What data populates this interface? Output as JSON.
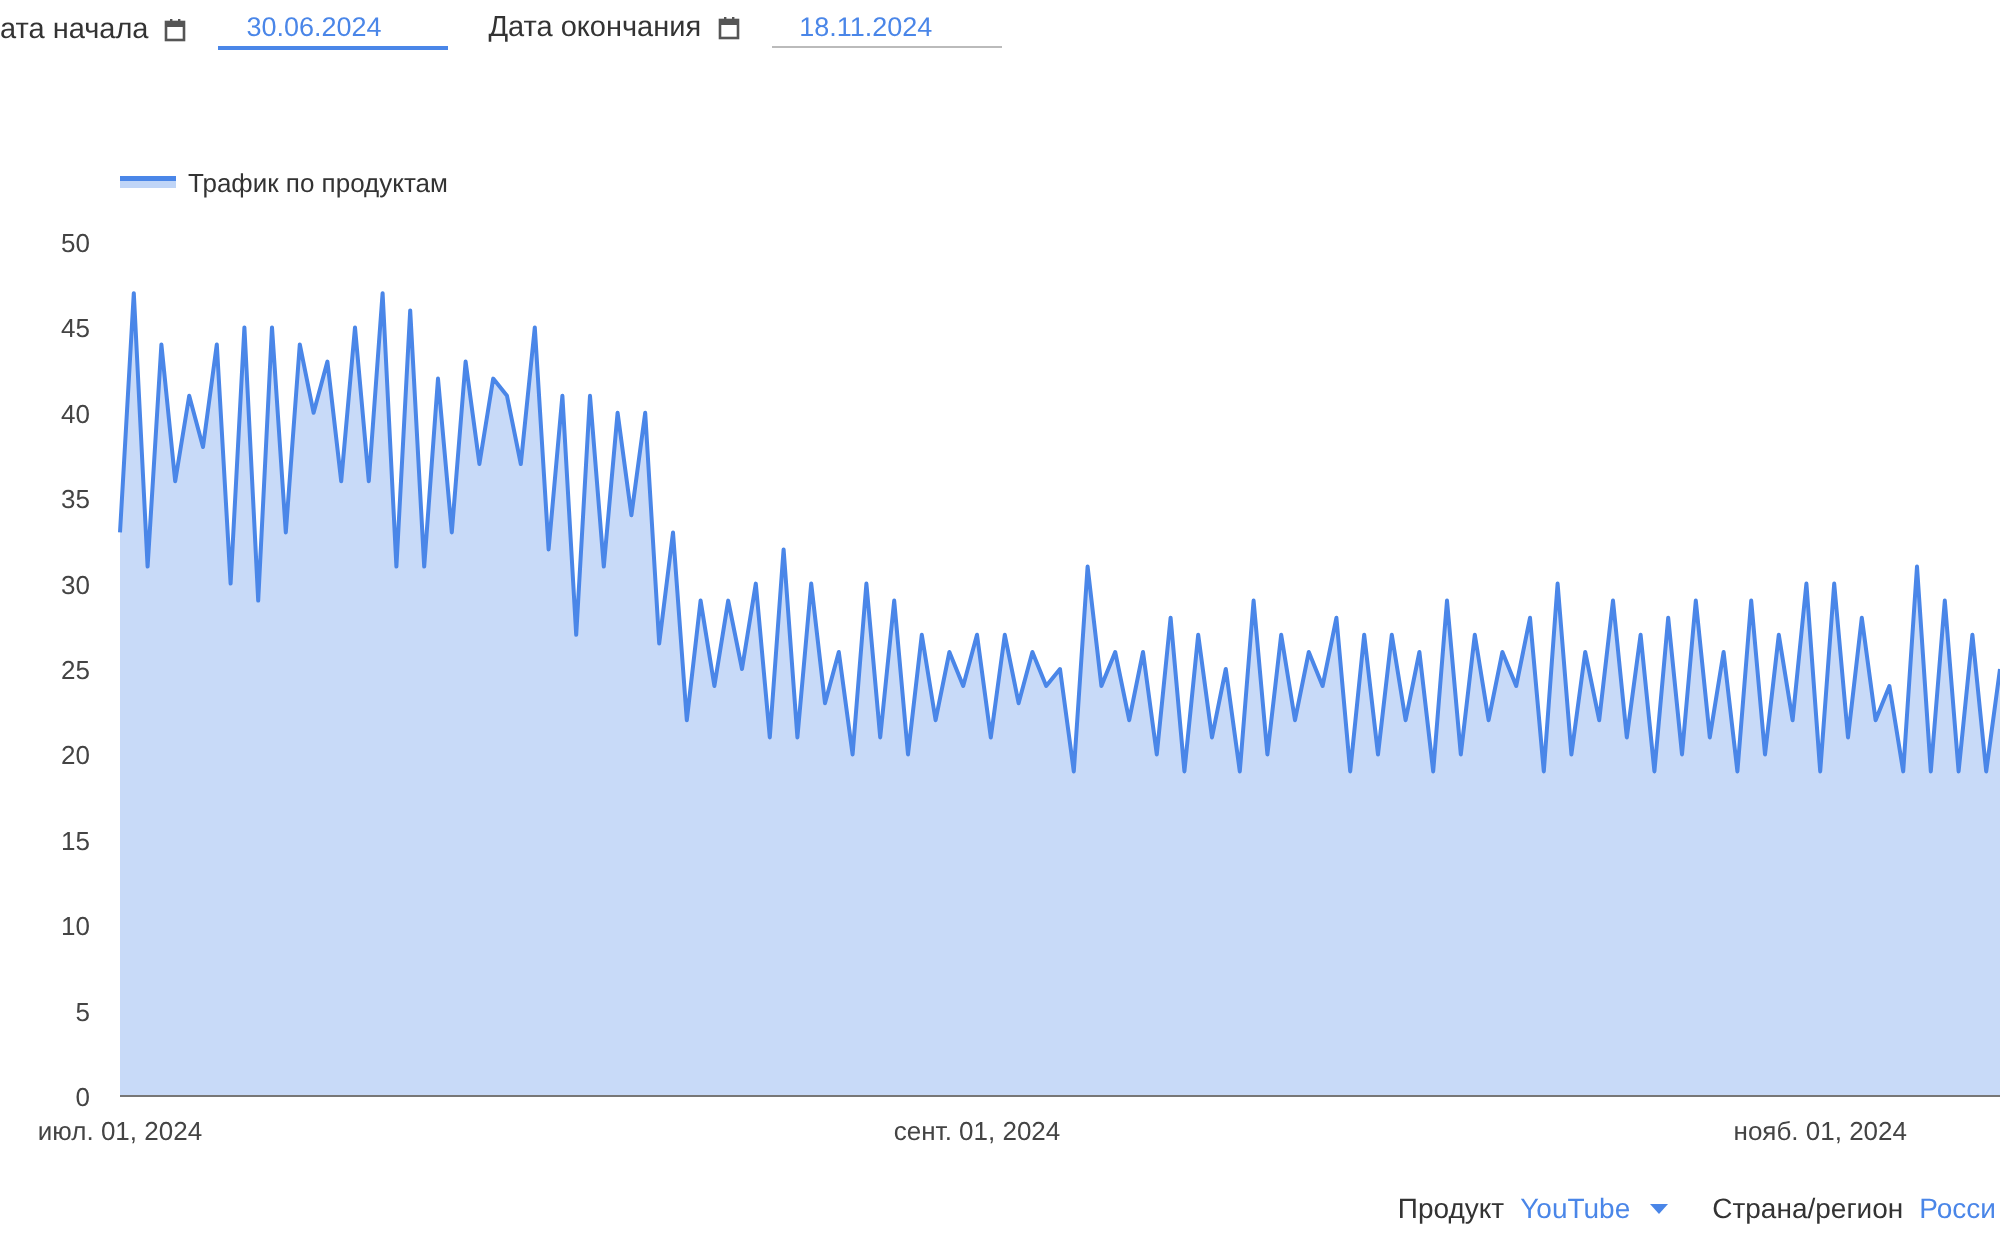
{
  "date_range": [
    {
      "label": "ата начала",
      "value": "30.06.2024",
      "focused": true
    },
    {
      "label": "Дата окончания",
      "value": "18.11.2024",
      "focused": false
    }
  ],
  "chart": {
    "chart_data": {
      "type": "area",
      "ylim": [
        0,
        50
      ],
      "yticks": [
        0,
        5,
        10,
        15,
        20,
        25,
        30,
        35,
        40,
        45,
        50
      ],
      "categories": [
        "июл. 01, 2024",
        null,
        null,
        null,
        null,
        null,
        null,
        null,
        null,
        null,
        null,
        null,
        null,
        null,
        null,
        null,
        null,
        null,
        null,
        null,
        null,
        null,
        null,
        null,
        null,
        null,
        null,
        null,
        null,
        null,
        null,
        null,
        null,
        null,
        null,
        null,
        null,
        null,
        null,
        null,
        null,
        null,
        null,
        null,
        null,
        null,
        null,
        null,
        null,
        null,
        null,
        null,
        null,
        null,
        null,
        null,
        null,
        null,
        null,
        null,
        null,
        null,
        "сент. 01, 2024",
        null,
        null,
        null,
        null,
        null,
        null,
        null,
        null,
        null,
        null,
        null,
        null,
        null,
        null,
        null,
        null,
        null,
        null,
        null,
        null,
        null,
        null,
        null,
        null,
        null,
        null,
        null,
        null,
        null,
        null,
        null,
        null,
        null,
        null,
        null,
        null,
        null,
        null,
        null,
        null,
        null,
        null,
        null,
        null,
        null,
        null,
        null,
        null,
        null,
        null,
        null,
        null,
        null,
        null,
        null,
        null,
        null,
        null,
        null,
        null,
        "нояб. 01, 2024",
        null,
        null,
        null,
        null,
        null,
        null,
        null,
        null,
        null,
        null,
        null,
        null,
        null
      ],
      "series": [
        {
          "name": "Трафик по продуктам",
          "color": "#4a86e8",
          "values": [
            33,
            47,
            31,
            44,
            36,
            41,
            38,
            44,
            30,
            45,
            29,
            45,
            33,
            44,
            40,
            43,
            36,
            45,
            36,
            47,
            31,
            46,
            31,
            42,
            33,
            43,
            37,
            42,
            41,
            37,
            45,
            32,
            41,
            27,
            41,
            31,
            40,
            34,
            40,
            26.5,
            33,
            22,
            29,
            24,
            29,
            25,
            30,
            21,
            32,
            21,
            30,
            23,
            26,
            20,
            30,
            21,
            29,
            20,
            27,
            22,
            26,
            24,
            27,
            21,
            27,
            23,
            26,
            24,
            25,
            19,
            31,
            24,
            26,
            22,
            26,
            20,
            28,
            19,
            27,
            21,
            25,
            19,
            29,
            20,
            27,
            22,
            26,
            24,
            28,
            19,
            27,
            20,
            27,
            22,
            26,
            19,
            29,
            20,
            27,
            22,
            26,
            24,
            28,
            19,
            30,
            20,
            26,
            22,
            29,
            21,
            27,
            19,
            28,
            20,
            29,
            21,
            26,
            19,
            29,
            20,
            27,
            22,
            30,
            19,
            30,
            21,
            28,
            22,
            24,
            19,
            31,
            19,
            29,
            19,
            27,
            19,
            25
          ]
        }
      ]
    }
  },
  "filters": [
    {
      "label": "Продукт",
      "value": "YouTube",
      "kind": "dropdown"
    },
    {
      "label": "Страна/регион",
      "value": "Росси",
      "kind": "text"
    }
  ]
}
